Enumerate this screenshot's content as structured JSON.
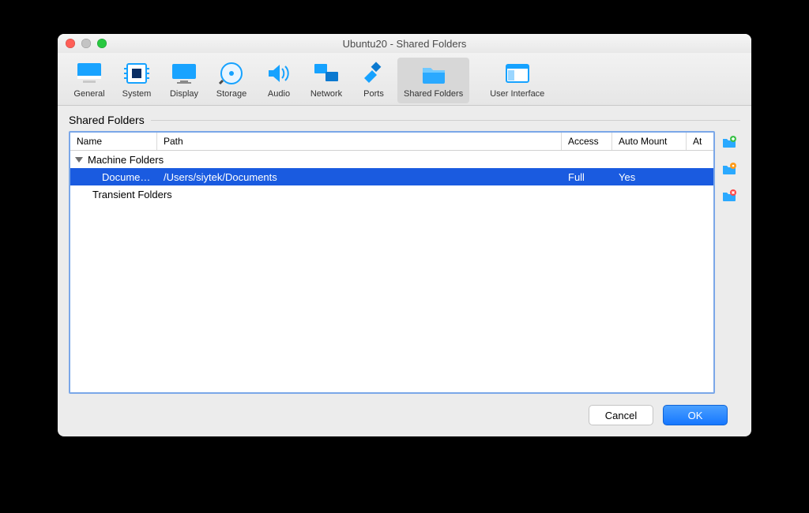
{
  "window": {
    "title": "Ubuntu20 - Shared Folders"
  },
  "toolbar": {
    "items": [
      {
        "id": "general",
        "label": "General"
      },
      {
        "id": "system",
        "label": "System"
      },
      {
        "id": "display",
        "label": "Display"
      },
      {
        "id": "storage",
        "label": "Storage"
      },
      {
        "id": "audio",
        "label": "Audio"
      },
      {
        "id": "network",
        "label": "Network"
      },
      {
        "id": "ports",
        "label": "Ports"
      },
      {
        "id": "shared",
        "label": "Shared Folders",
        "selected": true
      },
      {
        "id": "ui",
        "label": "User Interface"
      }
    ]
  },
  "section": {
    "title": "Shared Folders"
  },
  "table": {
    "headers": {
      "name": "Name",
      "path": "Path",
      "access": "Access",
      "auto": "Auto Mount",
      "at": "At"
    },
    "groups": [
      {
        "label": "Machine Folders",
        "expanded": true,
        "rows": [
          {
            "name": "Documents",
            "path": "/Users/siytek/Documents",
            "access": "Full",
            "auto": "Yes",
            "at": "",
            "selected": true
          }
        ]
      },
      {
        "label": "Transient Folders",
        "rows": []
      }
    ]
  },
  "side": {
    "add": "add-folder",
    "edit": "edit-folder",
    "del": "delete-folder"
  },
  "footer": {
    "cancel": "Cancel",
    "ok": "OK"
  },
  "colors": {
    "accent": "#1a5be0"
  }
}
